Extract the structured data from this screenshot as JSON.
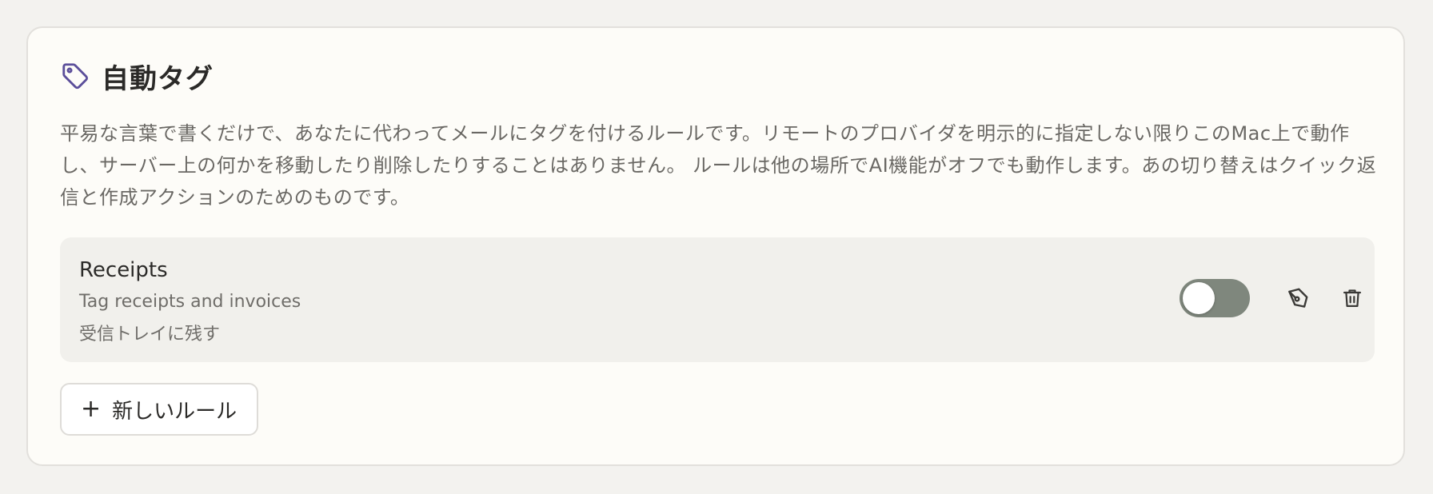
{
  "section": {
    "icon": "tag-icon",
    "title": "自動タグ",
    "description": "平易な言葉で書くだけで、あなたに代わってメールにタグを付けるルールです。リモートのプロバイダを明示的に指定しない限りこのMac上で動作し、サーバー上の何かを移動したり削除したりすることはありません。 ルールは他の場所でAI機能がオフでも動作します。あの切り替えはクイック返信と作成アクションのためのものです。"
  },
  "rules": [
    {
      "name": "Receipts",
      "description": "Tag receipts and invoices",
      "action": "受信トレイに残す",
      "enabled": false,
      "edit_icon": "pen-icon",
      "delete_icon": "trash-icon"
    }
  ],
  "new_rule_button": {
    "icon": "plus-icon",
    "label": "新しいルール"
  },
  "colors": {
    "accent_tag": "#5b4e9a",
    "toggle_track": "#7f877d",
    "card_background": "#fdfcf8",
    "page_background": "#f3f2ef"
  }
}
